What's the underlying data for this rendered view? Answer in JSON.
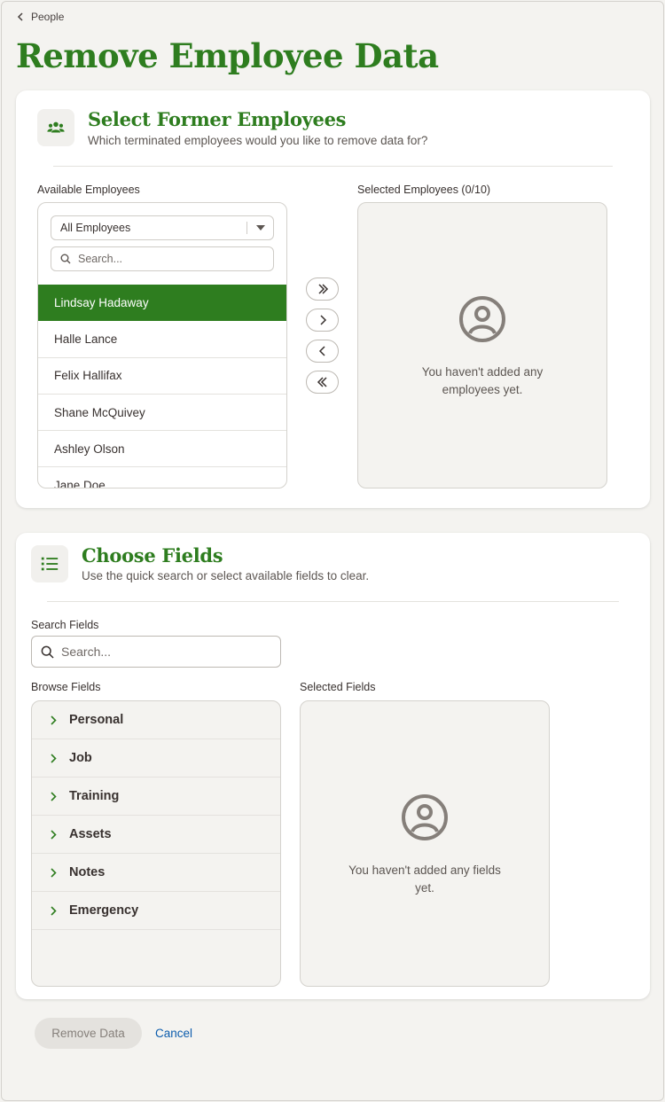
{
  "breadcrumb": {
    "back_label": "People"
  },
  "page": {
    "title": "Remove Employee Data"
  },
  "employees_section": {
    "title": "Select Former Employees",
    "subtitle": "Which terminated employees would you like to remove data for?",
    "available_label": "Available Employees",
    "selected_label": "Selected Employees (0/10)",
    "filter_value": "All Employees",
    "search_placeholder": "Search...",
    "employees": [
      {
        "name": "Lindsay Hadaway",
        "selected": true
      },
      {
        "name": "Halle Lance",
        "selected": false
      },
      {
        "name": "Felix Hallifax",
        "selected": false
      },
      {
        "name": "Shane McQuivey",
        "selected": false
      },
      {
        "name": "Ashley Olson",
        "selected": false
      },
      {
        "name": "Jane Doe",
        "selected": false
      }
    ],
    "empty_text_line1": "You haven't added any",
    "empty_text_line2": "employees yet."
  },
  "fields_section": {
    "title": "Choose Fields",
    "subtitle": "Use the quick search or select available fields to clear.",
    "search_label": "Search Fields",
    "search_placeholder": "Search...",
    "browse_label": "Browse Fields",
    "selected_label": "Selected Fields",
    "categories": [
      "Personal",
      "Job",
      "Training",
      "Assets",
      "Notes",
      "Emergency"
    ],
    "empty_text_line1": "You haven't added any fields",
    "empty_text_line2": "yet."
  },
  "footer": {
    "remove_label": "Remove Data",
    "cancel_label": "Cancel"
  },
  "colors": {
    "brand_green": "#2e7d1f",
    "link_blue": "#0b5cad",
    "icon_gray": "#857f7a"
  }
}
